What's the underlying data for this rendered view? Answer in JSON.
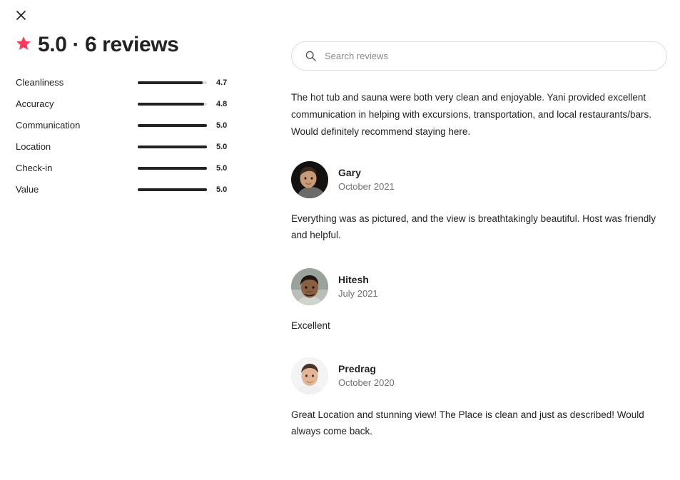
{
  "close_button": {
    "icon": "close-icon",
    "label": "Close"
  },
  "summary": {
    "star_icon": "star-icon",
    "headline": "5.0 · 6 reviews",
    "overall_rating": "5.0",
    "review_count": "6 reviews",
    "star_color": "#FF385C"
  },
  "categories": [
    {
      "label": "Cleanliness",
      "value": "4.7",
      "fill_pct": 94
    },
    {
      "label": "Accuracy",
      "value": "4.8",
      "fill_pct": 96
    },
    {
      "label": "Communication",
      "value": "5.0",
      "fill_pct": 100
    },
    {
      "label": "Location",
      "value": "5.0",
      "fill_pct": 100
    },
    {
      "label": "Check-in",
      "value": "5.0",
      "fill_pct": 100
    },
    {
      "label": "Value",
      "value": "5.0",
      "fill_pct": 100
    }
  ],
  "search": {
    "icon": "search-icon",
    "placeholder": "Search reviews",
    "value": ""
  },
  "intro_review_text": "The hot tub and sauna were both very clean and enjoyable. Yani provided excellent communication in helping with excursions, transportation, and local restaurants/bars. Would definitely recommend staying here.",
  "reviews": [
    {
      "name": "Gary",
      "date": "October 2021",
      "text": "Everything was as pictured, and the view is breathtakingly beautiful. Host was friendly and helpful.",
      "avatar_bg": "#141210",
      "avatar_skin": "#c99a78",
      "avatar_hair": "#3a2a1e",
      "avatar_shirt": "#6b6b6b"
    },
    {
      "name": "Hitesh",
      "date": "July 2021",
      "text": "Excellent",
      "avatar_bg": "#9aa39b",
      "avatar_skin": "#8a5f42",
      "avatar_hair": "#1c1512",
      "avatar_shirt": "#cfd4cf"
    },
    {
      "name": "Predrag",
      "date": "October 2020",
      "text": "Great Location and stunning view! The Place is clean and just as described! Would always come back.",
      "avatar_bg": "#f4f4f4",
      "avatar_skin": "#e2b596",
      "avatar_hair": "#4a342a",
      "avatar_shirt": "#f0f0f0"
    }
  ]
}
